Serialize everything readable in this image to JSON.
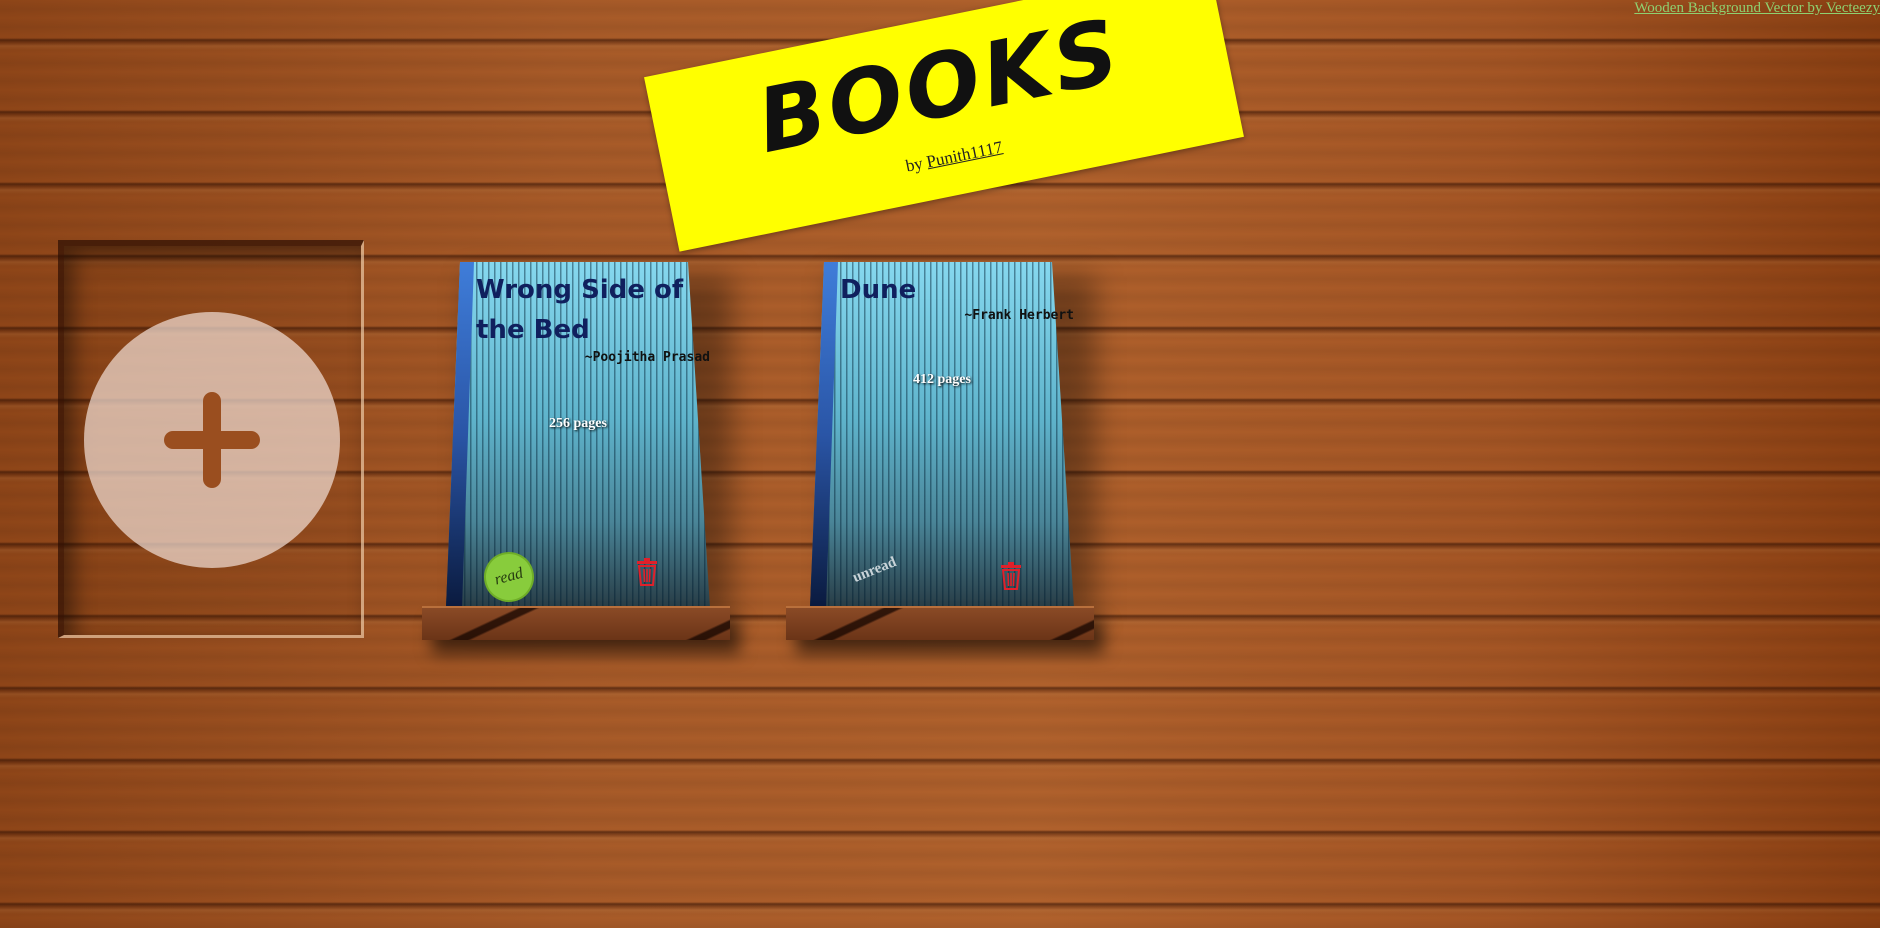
{
  "credit": {
    "label": "Wooden Background Vector by Vecteezy"
  },
  "header": {
    "title": "Books",
    "byline_prefix": "by",
    "author_link": "Punith1117"
  },
  "add_book": {
    "icon": "plus-icon"
  },
  "books": [
    {
      "title": "Wrong Side of the Bed",
      "author": "~Poojitha Prasad",
      "pages": "256 pages",
      "status": "read",
      "delete_icon": "trash-icon"
    },
    {
      "title": "Dune",
      "author": "~Frank Herbert",
      "pages": "412 pages",
      "status": "unread",
      "delete_icon": "trash-icon"
    }
  ],
  "colors": {
    "banner": "#ffff00",
    "read_badge": "#88cc3c",
    "trash": "#e0202a",
    "cover_top": "#86d8ef"
  }
}
